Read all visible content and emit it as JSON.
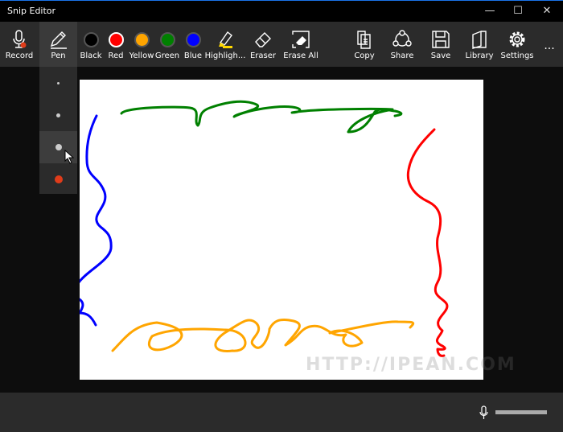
{
  "window": {
    "title": "Snip Editor",
    "minimize": "—",
    "maximize": "☐",
    "close": "✕"
  },
  "toolbar": {
    "record": "Record",
    "pen": "Pen",
    "colors": [
      {
        "label": "Black",
        "hex": "#000000"
      },
      {
        "label": "Red",
        "hex": "#ff0000"
      },
      {
        "label": "Yellow",
        "hex": "#ffa500"
      },
      {
        "label": "Green",
        "hex": "#008000"
      },
      {
        "label": "Blue",
        "hex": "#0000ff"
      }
    ],
    "highlighter": "Highligh...",
    "eraser": "Eraser",
    "erase_all": "Erase All",
    "copy": "Copy",
    "share": "Share",
    "save": "Save",
    "library": "Library",
    "settings": "Settings",
    "more": "..."
  },
  "pen_sizes": {
    "selected_index": 2,
    "selected_color": "#e03c1a"
  },
  "watermark": "HTTP://IPEAN.COM",
  "audio": {
    "volume_level": 1.0
  }
}
